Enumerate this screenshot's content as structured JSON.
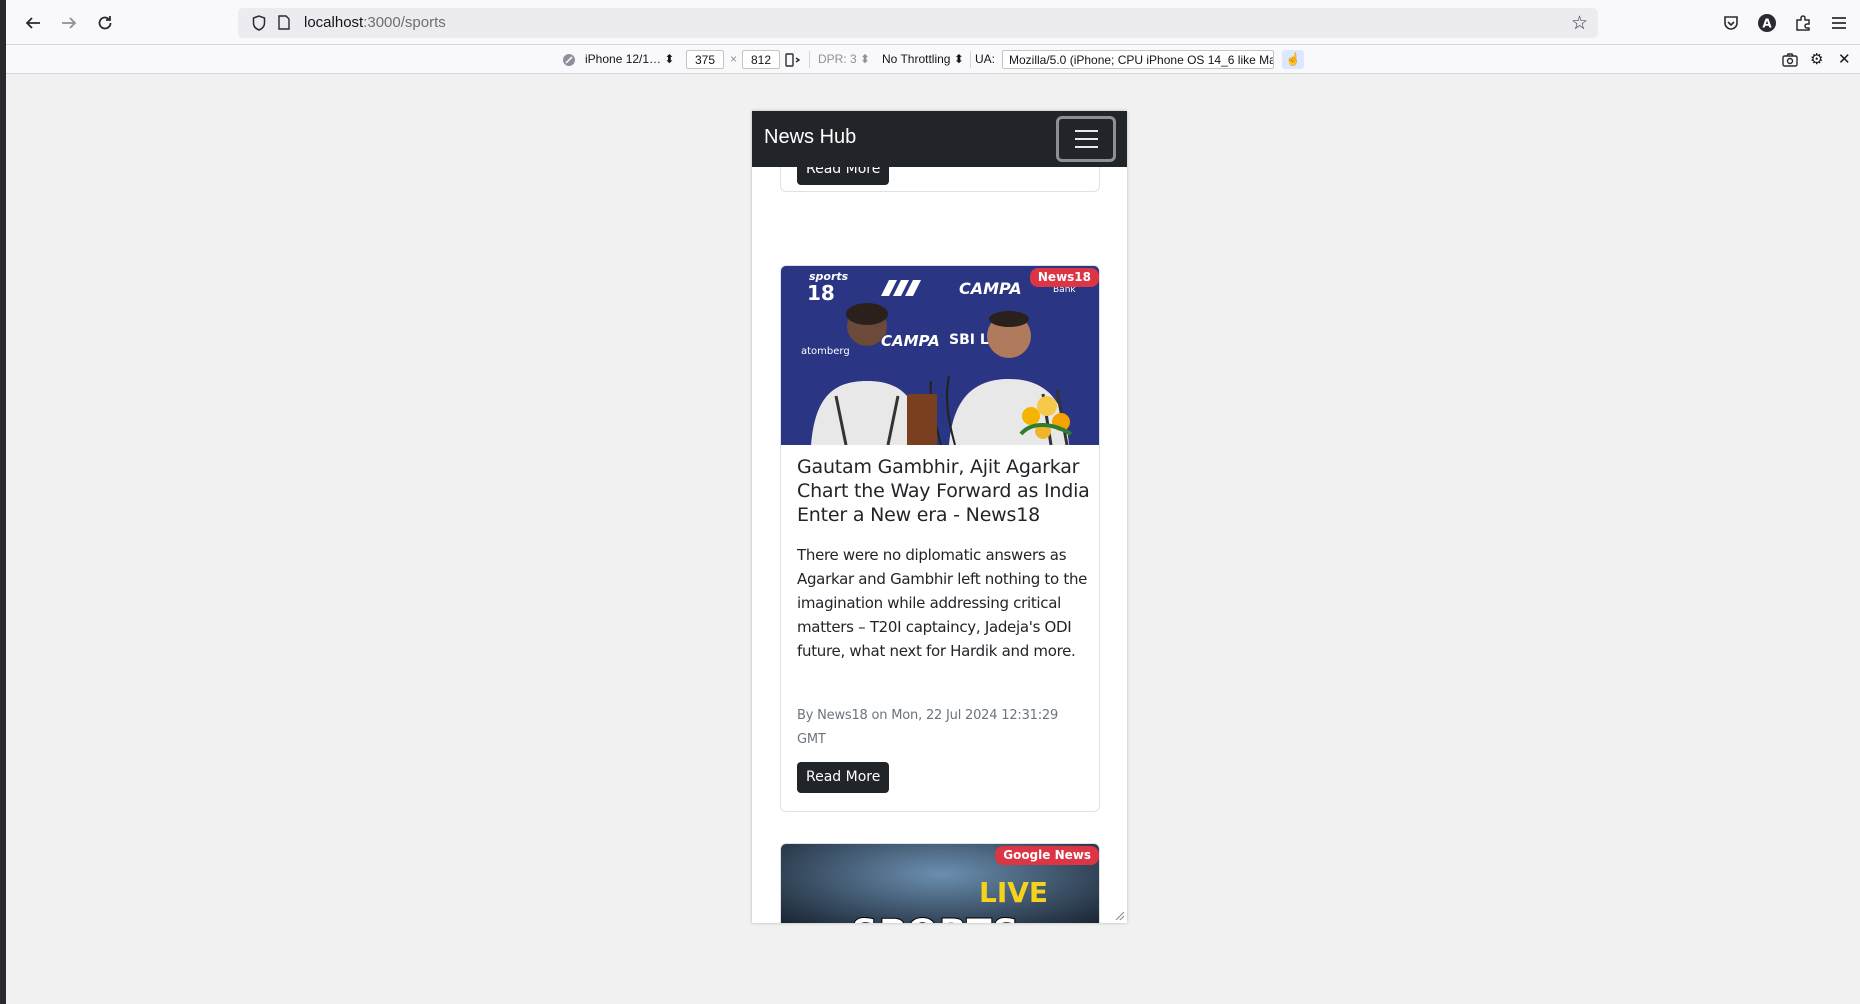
{
  "browser": {
    "url_host": "localhost",
    "url_path": ":3000/sports"
  },
  "rdm": {
    "device": "iPhone 12/1…",
    "width": "375",
    "times": "×",
    "height": "812",
    "dpr": "DPR: 3",
    "throttling": "No Throttling",
    "ua_label": "UA:",
    "ua_value": "Mozilla/5.0 (iPhone; CPU iPhone OS 14_6 like Mac"
  },
  "app": {
    "brand": "News Hub"
  },
  "articles": [
    {
      "read_more": "Read More"
    },
    {
      "source_badge": "News18",
      "title": "Gautam Gambhir, Ajit Agarkar Chart the Way Forward as India Enter a New era - News18",
      "description": "There were no diplomatic answers as Agarkar and Gambhir left nothing to the imagination while addressing critical matters – T20I captaincy, Jadeja's ODI future, what next for Hardik and more.",
      "meta": "By News18 on Mon, 22 Jul 2024 12:31:29 GMT",
      "read_more": "Read More",
      "image_text": [
        "sports",
        "18",
        "CAMPA",
        "Bank",
        "atomberg",
        "CAMPA",
        "SBI LIFE"
      ]
    },
    {
      "source_badge": "Google News",
      "image_text": [
        "LIVE",
        "SPORTS"
      ]
    }
  ]
}
